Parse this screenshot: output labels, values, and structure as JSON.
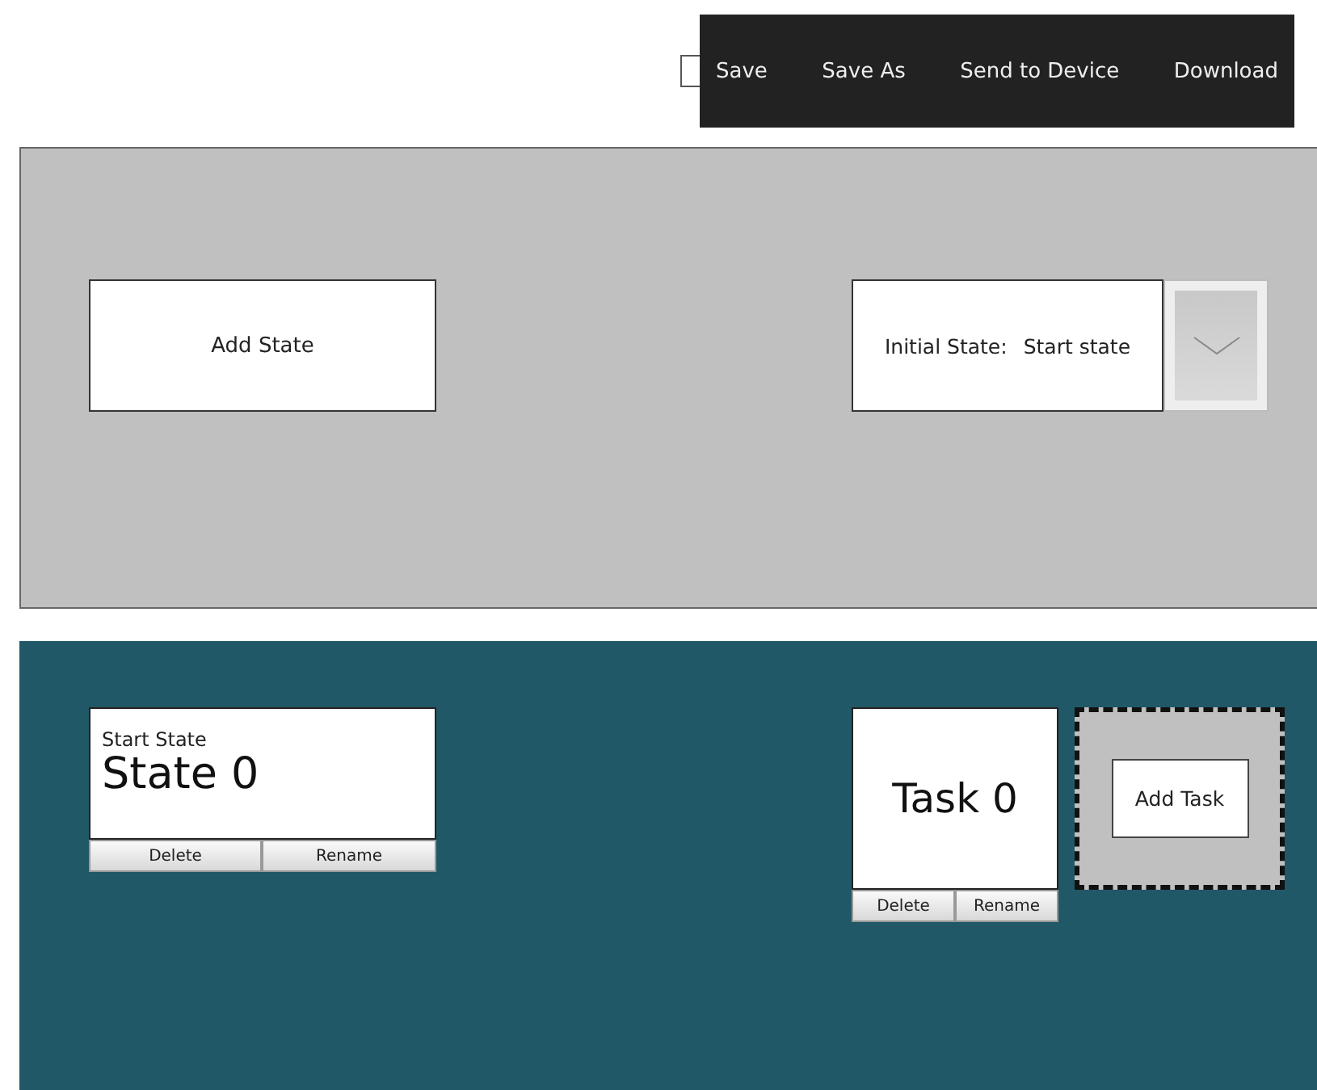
{
  "toolbar": {
    "items": [
      "Save",
      "Save As",
      "Send to Device",
      "Download"
    ]
  },
  "state_panel": {
    "add_button": "Add State",
    "initial_state": {
      "label": "Initial State:",
      "value": "Start state"
    }
  },
  "state_card": {
    "caption": "Start State",
    "name": "State 0",
    "actions": [
      "Delete",
      "Rename"
    ]
  },
  "task_card": {
    "name": "Task 0",
    "actions": [
      "Delete",
      "Rename"
    ]
  },
  "add_task": {
    "label": "Add Task"
  }
}
